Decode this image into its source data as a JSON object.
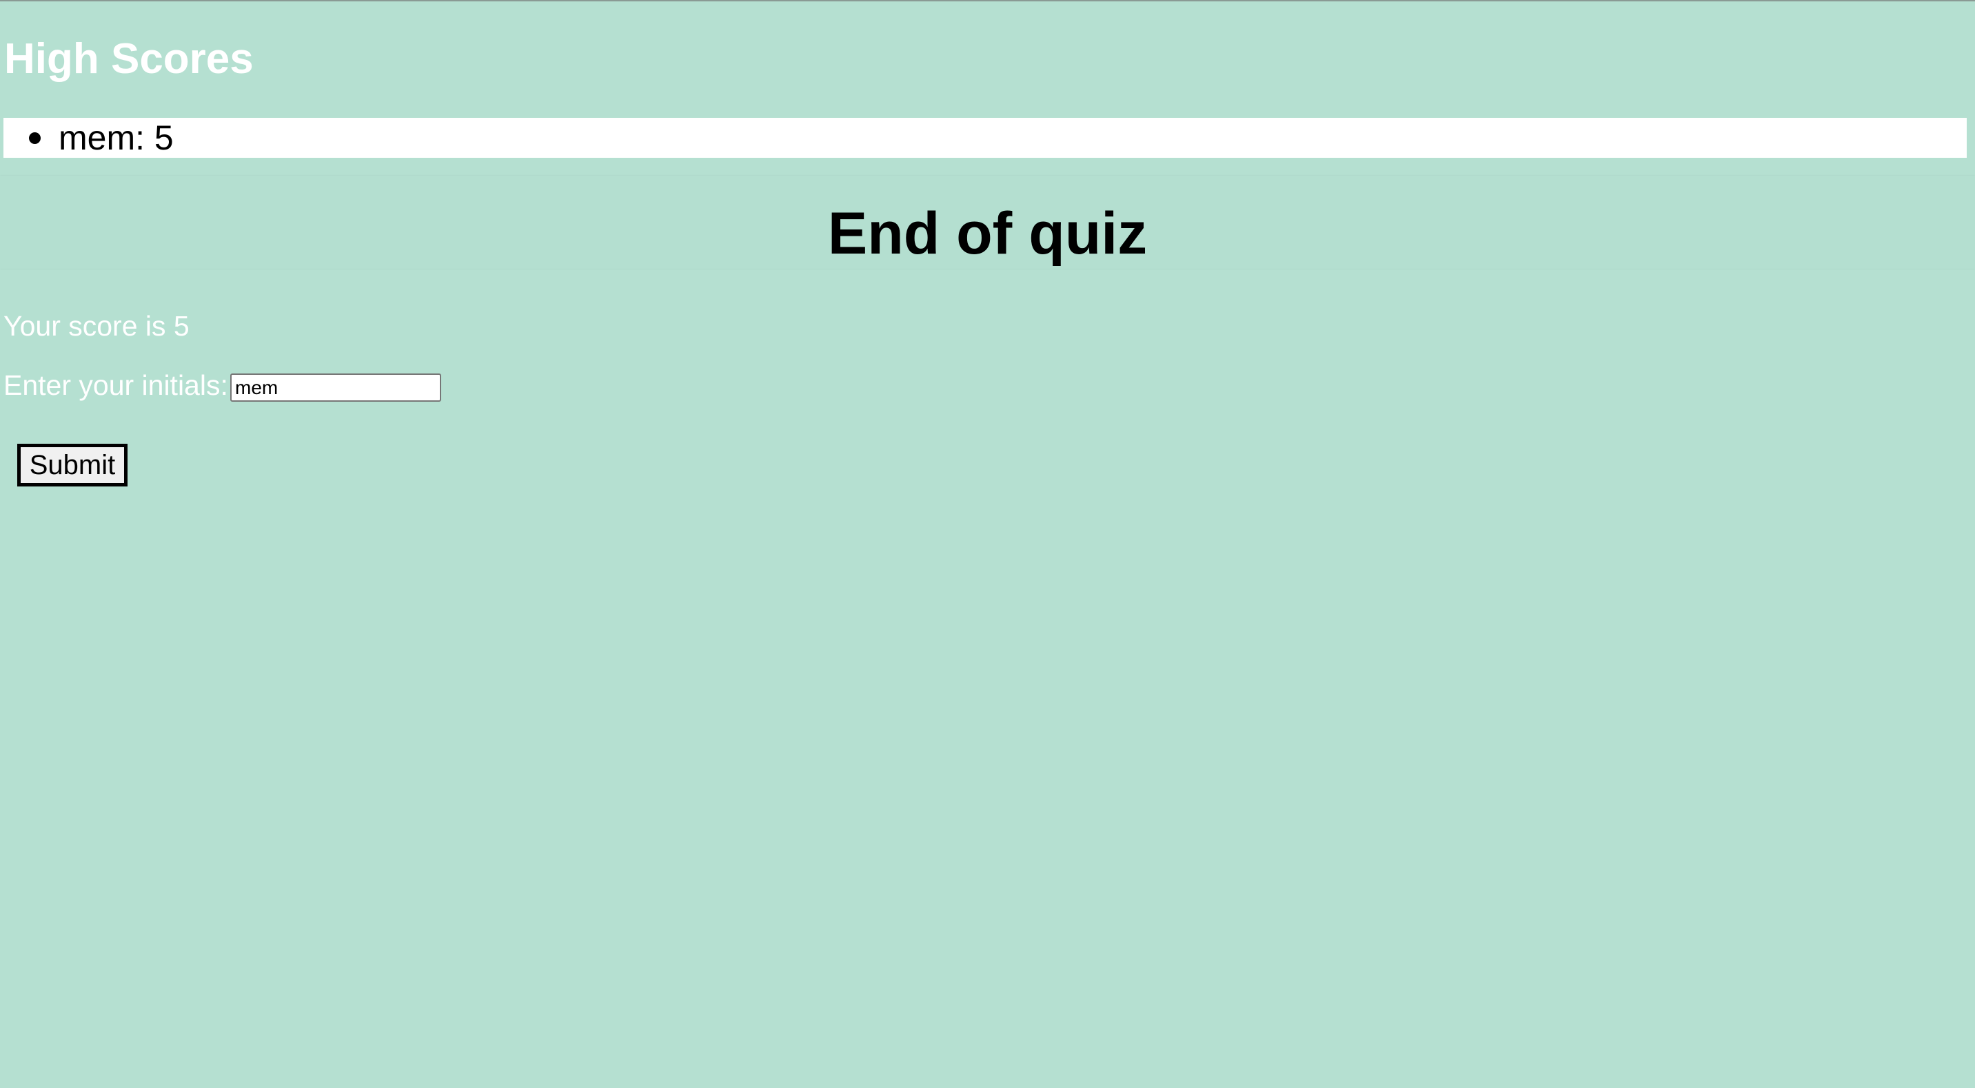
{
  "high_scores": {
    "title": "High Scores",
    "entries": [
      {
        "text": "mem: 5"
      }
    ]
  },
  "end_screen": {
    "title": "End of quiz",
    "score_text": "Your score is 5",
    "initials_label": "Enter your initials:",
    "initials_value": "mem",
    "submit_label": "Submit"
  },
  "colors": {
    "background": "#b5e0d1",
    "list_background": "#ffffff",
    "light_text": "#ffffff",
    "dark_text": "#000000"
  }
}
